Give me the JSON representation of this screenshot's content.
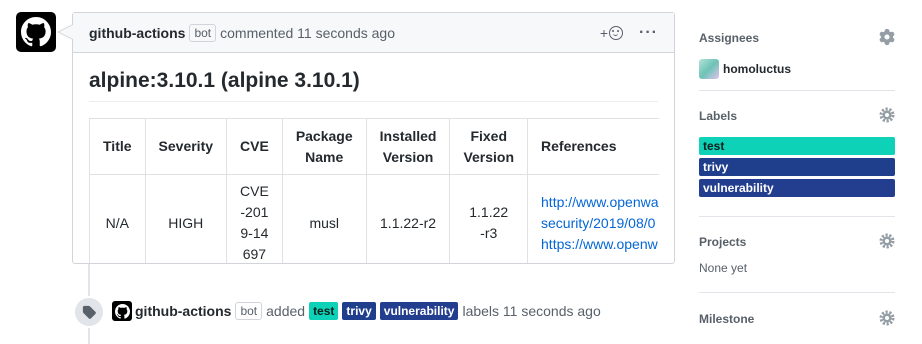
{
  "colors": {
    "label_test": "#0ed2b8",
    "label_trivy": "#1f3f8d",
    "label_vulnerability": "#243e8f",
    "link": "#0366d6"
  },
  "comment": {
    "author": "github-actions",
    "bot_badge": "bot",
    "action_text": "commented 11 seconds ago",
    "reaction_plus": "+",
    "heading": "alpine:3.10.1 (alpine 3.10.1)",
    "table": {
      "headers": [
        "Title",
        "Severity",
        "CVE",
        "Package Name",
        "Installed Version",
        "Fixed Version",
        "References"
      ],
      "rows": [
        {
          "title": "N/A",
          "severity": "HIGH",
          "cve": "CVE-2019-14697",
          "package": "musl",
          "installed": "1.1.22-r2",
          "fixed": "1.1.22-r3",
          "ref1": "http://www.openwall.com/lists/oss-",
          "ref2": "security/2019/08/0",
          "ref3": "https://www.openw"
        }
      ]
    }
  },
  "event": {
    "author": "github-actions",
    "bot_badge": "bot",
    "added": "added",
    "labels": [
      "test",
      "trivy",
      "vulnerability"
    ],
    "suffix": "labels 11 seconds ago"
  },
  "sidebar": {
    "assignees": {
      "title": "Assignees",
      "user": "homoluctus"
    },
    "labels": {
      "title": "Labels",
      "items": [
        "test",
        "trivy",
        "vulnerability"
      ]
    },
    "projects": {
      "title": "Projects",
      "value": "None yet"
    },
    "milestone": {
      "title": "Milestone"
    }
  },
  "icons": [
    "github-logo-icon",
    "smiley-icon",
    "kebab-icon",
    "tag-icon",
    "gear-icon"
  ]
}
